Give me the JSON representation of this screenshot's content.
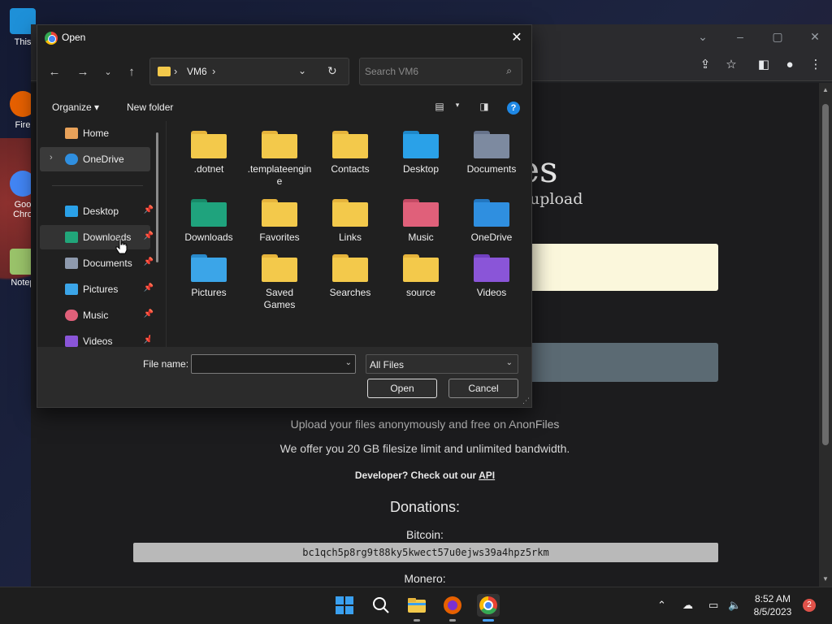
{
  "desktop": {
    "icons": [
      {
        "label": "This",
        "color": "#1e90d8"
      },
      {
        "label": "Fire",
        "color": "#e66000"
      },
      {
        "label": "Goo Chro",
        "color": "#4285f4"
      },
      {
        "label": "Notep",
        "color": "#9ac36a"
      }
    ]
  },
  "browser": {
    "page": {
      "logo_partial": "es",
      "logo_sub_partial": "upload",
      "tagline": "Upload your files anonymously and free on AnonFiles",
      "limit_text": "We offer you 20 GB filesize limit and unlimited bandwidth.",
      "developer_prefix": "Developer? Check out our ",
      "developer_link": "API",
      "donations_heading": "Donations:",
      "bitcoin_label": "Bitcoin:",
      "bitcoin_address": "bc1qch5p8rg9t88ky5kwect57u0ejws39a4hpz5rkm",
      "monero_label": "Monero:"
    }
  },
  "dialog": {
    "title": "Open",
    "address": {
      "path": "VM6"
    },
    "search": {
      "placeholder": "Search VM6"
    },
    "commands": {
      "organize": "Organize",
      "new_folder": "New folder"
    },
    "nav": [
      {
        "label": "Home",
        "icon": "home-icon",
        "color": "#e8a25a",
        "pinned": false
      },
      {
        "label": "OneDrive",
        "icon": "cloud-icon",
        "color": "#2f8fe0",
        "pinned": false
      },
      {
        "label": "Desktop",
        "icon": "desktop-icon",
        "color": "#2aa1e8",
        "pinned": true
      },
      {
        "label": "Downloads",
        "icon": "downloads-icon",
        "color": "#21a67a",
        "pinned": true
      },
      {
        "label": "Documents",
        "icon": "documents-icon",
        "color": "#8e9aae",
        "pinned": true
      },
      {
        "label": "Pictures",
        "icon": "pictures-icon",
        "color": "#3ba5e8",
        "pinned": true
      },
      {
        "label": "Music",
        "icon": "music-icon",
        "color": "#e0607a",
        "pinned": true
      },
      {
        "label": "Videos",
        "icon": "videos-icon",
        "color": "#8a55d8",
        "pinned": true
      }
    ],
    "files": [
      {
        "label": ".dotnet",
        "color": "#f3c94b"
      },
      {
        "label": ".templateengine",
        "color": "#f3c94b"
      },
      {
        "label": "Contacts",
        "color": "#f3c94b"
      },
      {
        "label": "Desktop",
        "color": "#2aa1e8"
      },
      {
        "label": "Documents",
        "color": "#7d8aa0"
      },
      {
        "label": "Downloads",
        "color": "#1fa37d"
      },
      {
        "label": "Favorites",
        "color": "#f3c94b"
      },
      {
        "label": "Links",
        "color": "#f3c94b"
      },
      {
        "label": "Music",
        "color": "#e0607a"
      },
      {
        "label": "OneDrive",
        "color": "#2f8fe0"
      },
      {
        "label": "Pictures",
        "color": "#3ba5e8"
      },
      {
        "label": "Saved Games",
        "color": "#f3c94b"
      },
      {
        "label": "Searches",
        "color": "#f3c94b"
      },
      {
        "label": "source",
        "color": "#f3c94b"
      },
      {
        "label": "Videos",
        "color": "#8a55d8"
      }
    ],
    "file_name": {
      "label": "File name:",
      "value": ""
    },
    "file_type": {
      "value": "All Files"
    },
    "buttons": {
      "open": "Open",
      "cancel": "Cancel"
    }
  },
  "taskbar": {
    "apps": [
      {
        "name": "start-icon",
        "color": "#3aa0f0"
      },
      {
        "name": "search-icon",
        "color": "#ffffff"
      },
      {
        "name": "file-explorer-icon",
        "color": "#f3c94b"
      },
      {
        "name": "firefox-icon",
        "color": "#e66000"
      },
      {
        "name": "chrome-icon",
        "color": "#4285f4"
      }
    ],
    "time": "8:52 AM",
    "date": "8/5/2023",
    "notifications": "2"
  }
}
